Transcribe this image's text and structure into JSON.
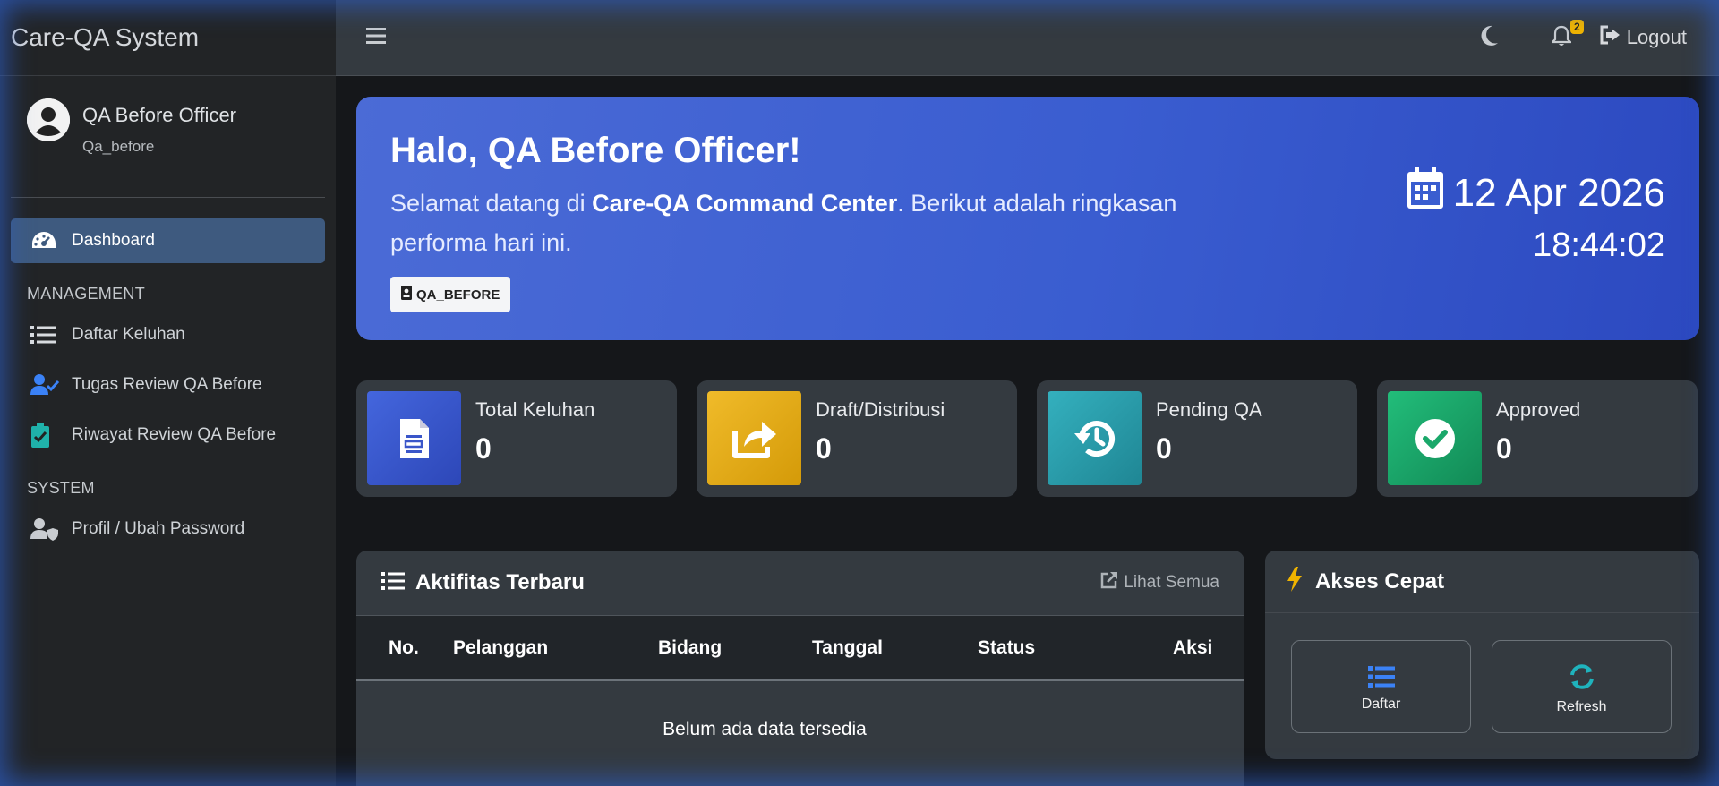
{
  "app": {
    "brand": "Care-QA System"
  },
  "user": {
    "name": "QA Before Officer",
    "username": "Qa_before"
  },
  "sidebar": {
    "dashboard": "Dashboard",
    "management_header": "MANAGEMENT",
    "management_items": [
      "Daftar Keluhan",
      "Tugas Review QA Before",
      "Riwayat Review QA Before"
    ],
    "system_header": "SYSTEM",
    "system_items": [
      "Profil / Ubah Password"
    ]
  },
  "topbar": {
    "notification_count": "2",
    "logout": "Logout"
  },
  "hero": {
    "greeting": "Halo, QA Before Officer!",
    "sub_prefix": "Selamat datang di ",
    "sub_bold": "Care-QA Command Center",
    "sub_suffix": ". Berikut adalah ringkasan performa hari ini.",
    "role": "QA_BEFORE",
    "date": "12 Apr 2026",
    "time": "18:44:02"
  },
  "stats": [
    {
      "label": "Total Keluhan",
      "value": "0",
      "color": "#3a56c9"
    },
    {
      "label": "Draft/Distribusi",
      "value": "0",
      "color": "#e1a60f"
    },
    {
      "label": "Pending QA",
      "value": "0",
      "color": "#2a9aa8"
    },
    {
      "label": "Approved",
      "value": "0",
      "color": "#1aa86a"
    }
  ],
  "activity": {
    "title": "Aktifitas Terbaru",
    "view_all": "Lihat Semua",
    "columns": [
      "No.",
      "Pelanggan",
      "Bidang",
      "Tanggal",
      "Status",
      "Aksi"
    ],
    "empty": "Belum ada data tersedia"
  },
  "quick": {
    "title": "Akses Cepat",
    "buttons": [
      "Daftar",
      "Refresh"
    ]
  }
}
